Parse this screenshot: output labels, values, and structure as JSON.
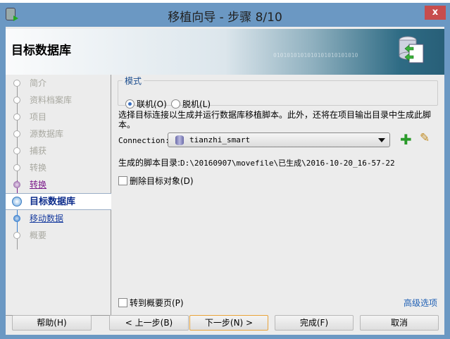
{
  "window": {
    "title": "移植向导 - 步骤 8/10",
    "close": "x"
  },
  "banner": {
    "title": "目标数据库",
    "bits": "0101010101010101010101010"
  },
  "steps": [
    {
      "label": "简介",
      "state": "disabled"
    },
    {
      "label": "资料档案库",
      "state": "disabled"
    },
    {
      "label": "项目",
      "state": "disabled"
    },
    {
      "label": "源数据库",
      "state": "disabled"
    },
    {
      "label": "捕获",
      "state": "disabled"
    },
    {
      "label": "转换",
      "state": "disabled"
    },
    {
      "label": "转换",
      "state": "done"
    },
    {
      "label": "目标数据库",
      "state": "current"
    },
    {
      "label": "移动数据",
      "state": "next"
    },
    {
      "label": "概要",
      "state": "disabled"
    }
  ],
  "mode": {
    "legend": "模式",
    "online": "联机(O)",
    "offline": "脱机(L)",
    "selected": "online"
  },
  "description": "选择目标连接以生成并运行数据库移植脚本。此外，还将在项目输出目录中生成此脚本。",
  "connection": {
    "label": "Connection:",
    "value": "tianzhi_smart"
  },
  "script_dir": {
    "label": "生成的脚本目录:",
    "value": "D:\\20160907\\movefile\\已生成\\2016-10-20_16-57-22"
  },
  "delete_target": {
    "label": "删除目标对象(D)",
    "checked": false
  },
  "goto_summary": {
    "label": "转到概要页(P)",
    "checked": false
  },
  "advanced": "高级选项",
  "buttons": {
    "help": "帮助(H)",
    "back": "< 上一步(B)",
    "next": "下一步(N) >",
    "finish": "完成(F)",
    "cancel": "取消"
  }
}
